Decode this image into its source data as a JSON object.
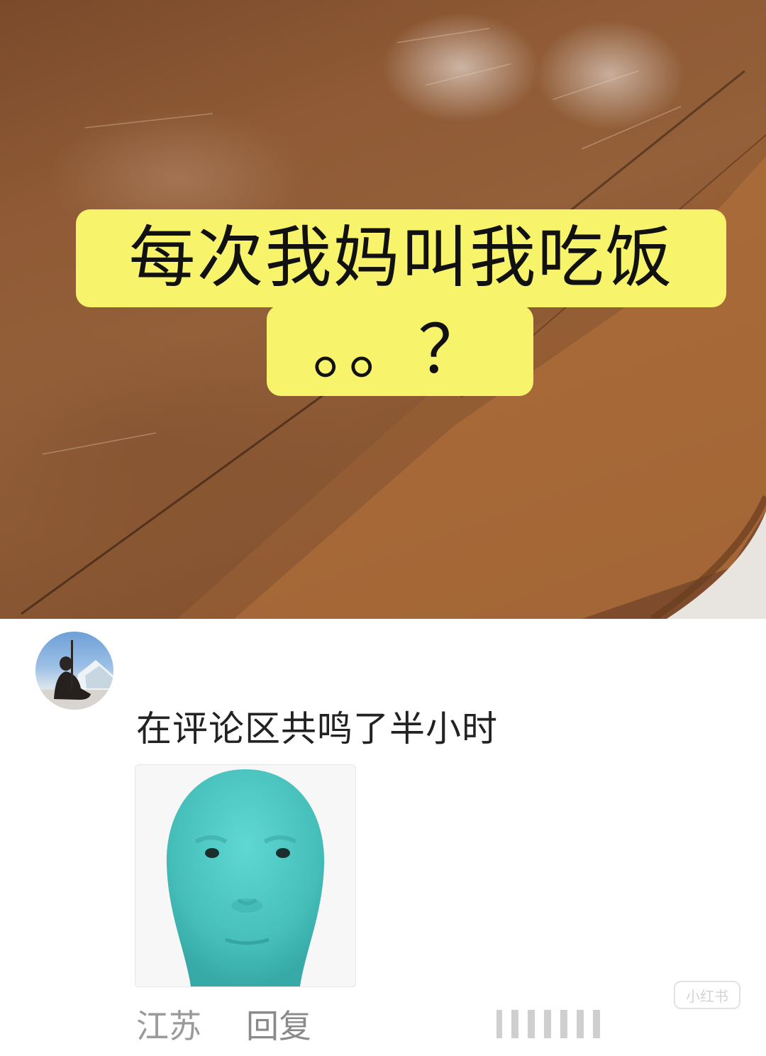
{
  "post": {
    "caption_line1": "每次我妈叫我吃饭",
    "caption_line2": "。。？"
  },
  "comment": {
    "text": "在评论区共鸣了半小时",
    "location": "江苏",
    "reply_label": "回复",
    "watermark": "小红书"
  },
  "colors": {
    "caption_bg": "#f7f36b",
    "sticker_face": "#4fc9c6",
    "meta_text": "#9a9a9a"
  },
  "icons": {
    "avatar": "person-silhouette",
    "sticker": "teal-face-emoji"
  }
}
